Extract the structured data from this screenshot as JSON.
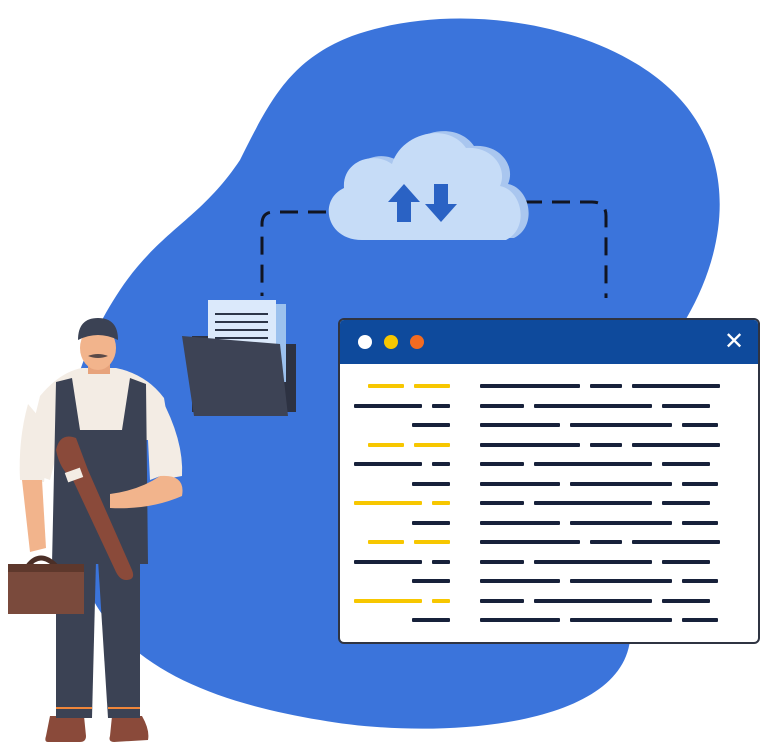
{
  "illustration": {
    "background_blob_color": "#3b74db",
    "cloud": {
      "icon": "cloud-upload-download-icon",
      "color": "#c6dcf7",
      "arrow_color": "#2a62c4"
    },
    "folder": {
      "icon": "folder-with-documents-icon",
      "color": "#3d4355"
    },
    "worker": {
      "icon": "plumber-with-wrench-and-toolbox",
      "overall_color": "#3b4254",
      "wrench_color": "#8a4a3a",
      "toolbox_color": "#7a4a3c"
    },
    "connector_style": "dashed"
  },
  "window": {
    "titlebar_color": "#0e4a9c",
    "dot_colors": [
      "#ffffff",
      "#f7c700",
      "#f26b21"
    ],
    "close_icon": "close-icon",
    "close_glyph": "✕",
    "code_colors": {
      "accent": "#f7c700",
      "text": "#17213a"
    },
    "code_rows": [
      {
        "gutter": [
          [
            "y",
            36
          ],
          [
            "y",
            36
          ]
        ],
        "code": [
          [
            "d",
            100
          ],
          [
            "d",
            32
          ],
          [
            "d",
            88
          ]
        ]
      },
      {
        "gutter": [
          [
            "d",
            68
          ],
          [
            "d",
            18
          ]
        ],
        "code": [
          [
            "d",
            44
          ],
          [
            "d",
            118
          ],
          [
            "d",
            48
          ]
        ]
      },
      {
        "gutter": [
          [
            "d",
            38
          ]
        ],
        "code": [
          [
            "d",
            80
          ],
          [
            "d",
            102
          ],
          [
            "d",
            36
          ]
        ]
      },
      {
        "gutter": [
          [
            "y",
            36
          ],
          [
            "y",
            36
          ]
        ],
        "code": [
          [
            "d",
            100
          ],
          [
            "d",
            32
          ],
          [
            "d",
            88
          ]
        ]
      },
      {
        "gutter": [
          [
            "d",
            68
          ],
          [
            "d",
            18
          ]
        ],
        "code": [
          [
            "d",
            44
          ],
          [
            "d",
            118
          ],
          [
            "d",
            48
          ]
        ]
      },
      {
        "gutter": [
          [
            "d",
            38
          ]
        ],
        "code": [
          [
            "d",
            80
          ],
          [
            "d",
            102
          ],
          [
            "d",
            36
          ]
        ]
      },
      {
        "gutter": [
          [
            "y",
            68
          ],
          [
            "y",
            18
          ]
        ],
        "code": [
          [
            "d",
            44
          ],
          [
            "d",
            118
          ],
          [
            "d",
            48
          ]
        ]
      },
      {
        "gutter": [
          [
            "d",
            38
          ]
        ],
        "code": [
          [
            "d",
            80
          ],
          [
            "d",
            102
          ],
          [
            "d",
            36
          ]
        ]
      },
      {
        "gutter": [
          [
            "y",
            36
          ],
          [
            "y",
            36
          ]
        ],
        "code": [
          [
            "d",
            100
          ],
          [
            "d",
            32
          ],
          [
            "d",
            88
          ]
        ]
      },
      {
        "gutter": [
          [
            "d",
            68
          ],
          [
            "d",
            18
          ]
        ],
        "code": [
          [
            "d",
            44
          ],
          [
            "d",
            118
          ],
          [
            "d",
            48
          ]
        ]
      },
      {
        "gutter": [
          [
            "d",
            38
          ]
        ],
        "code": [
          [
            "d",
            80
          ],
          [
            "d",
            102
          ],
          [
            "d",
            36
          ]
        ]
      },
      {
        "gutter": [
          [
            "y",
            68
          ],
          [
            "y",
            18
          ]
        ],
        "code": [
          [
            "d",
            44
          ],
          [
            "d",
            118
          ],
          [
            "d",
            48
          ]
        ]
      },
      {
        "gutter": [
          [
            "d",
            38
          ]
        ],
        "code": [
          [
            "d",
            80
          ],
          [
            "d",
            102
          ],
          [
            "d",
            36
          ]
        ]
      }
    ]
  }
}
